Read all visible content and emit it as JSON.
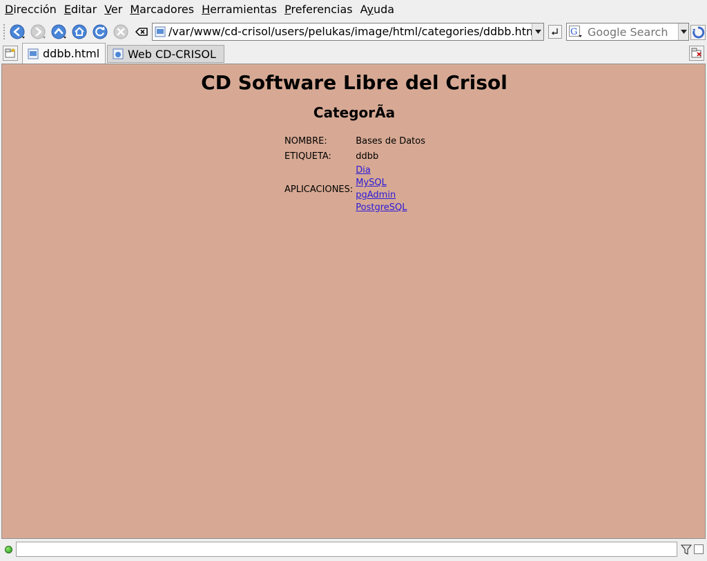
{
  "menubar": {
    "items": [
      {
        "label": "Dirección",
        "key": "D"
      },
      {
        "label": "Editar",
        "key": "E"
      },
      {
        "label": "Ver",
        "key": "V"
      },
      {
        "label": "Marcadores",
        "key": "M"
      },
      {
        "label": "Herramientas",
        "key": "H"
      },
      {
        "label": "Preferencias",
        "key": "P"
      },
      {
        "label": "Ayuda",
        "key": "y"
      }
    ]
  },
  "toolbar": {
    "buttons": [
      "back-icon",
      "forward-icon",
      "up-icon",
      "home-icon",
      "reload-icon",
      "stop-icon",
      "clear-location-icon"
    ],
    "url": "/var/www/cd-crisol/users/pelukas/image/html/categories/ddbb.html",
    "go_icon": "go-icon",
    "search_engine_icon": "google-icon",
    "search_placeholder": "Google Search"
  },
  "tabs": {
    "items": [
      {
        "label": "ddbb.html",
        "active": true
      },
      {
        "label": "Web CD-CRISOL",
        "active": false
      }
    ]
  },
  "page": {
    "title": "CD Software Libre del Crisol",
    "subtitle": "CategorÃa",
    "fields": {
      "name_label": "NOMBRE:",
      "name_value": "Bases de Datos",
      "tag_label": "ETIQUETA:",
      "tag_value": "ddbb",
      "apps_label": "APLICACIONES:"
    },
    "applications": [
      "Dia",
      "MySQL",
      "pgAdmin",
      "PostgreSQL"
    ],
    "background_color": "#d7a994",
    "link_color": "#2a1ad8"
  },
  "statusbar": {
    "text": "",
    "indicator_color": "#1e9a1a"
  }
}
